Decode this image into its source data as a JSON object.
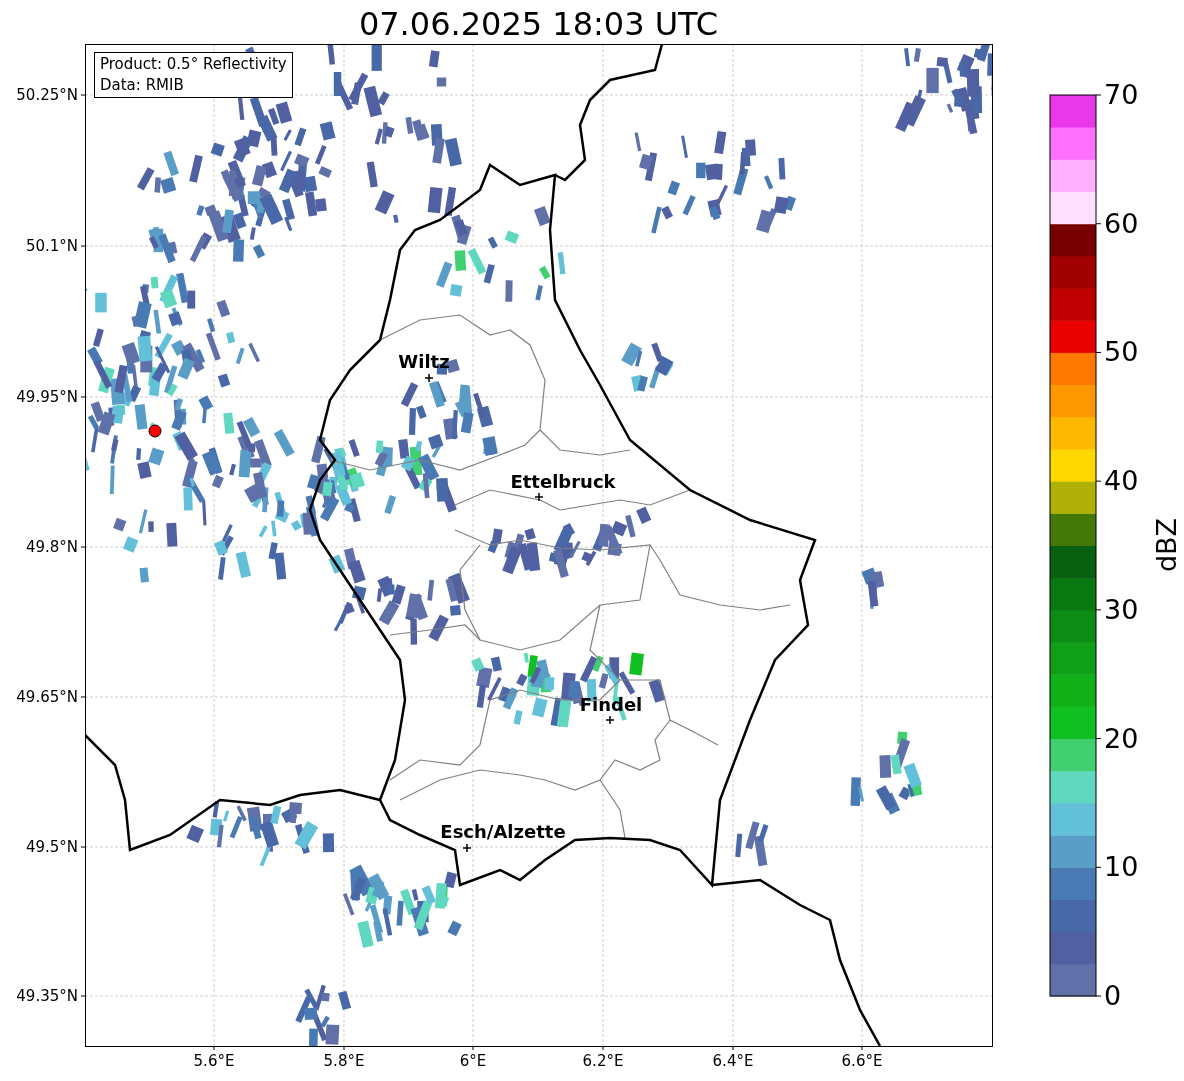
{
  "title": "07.06.2025 18:03 UTC",
  "legend": {
    "lines": [
      "Product: 0.5° Reflectivity",
      "Data: RMIB"
    ]
  },
  "x_axis": {
    "ticks": [
      "5.6°E",
      "5.8°E",
      "6°E",
      "6.2°E",
      "6.4°E",
      "6.6°E"
    ]
  },
  "y_axis": {
    "ticks": [
      "50.25°N",
      "50.1°N",
      "49.95°N",
      "49.8°N",
      "49.65°N",
      "49.5°N",
      "49.35°N"
    ]
  },
  "cities": [
    {
      "name": "Wiltz"
    },
    {
      "name": "Ettelbruck"
    },
    {
      "name": "Findel"
    },
    {
      "name": "Esch/Alzette"
    }
  ],
  "colorbar": {
    "label": "dBZ",
    "ticks": [
      "70",
      "60",
      "50",
      "40",
      "30",
      "20",
      "10",
      "0"
    ]
  }
}
